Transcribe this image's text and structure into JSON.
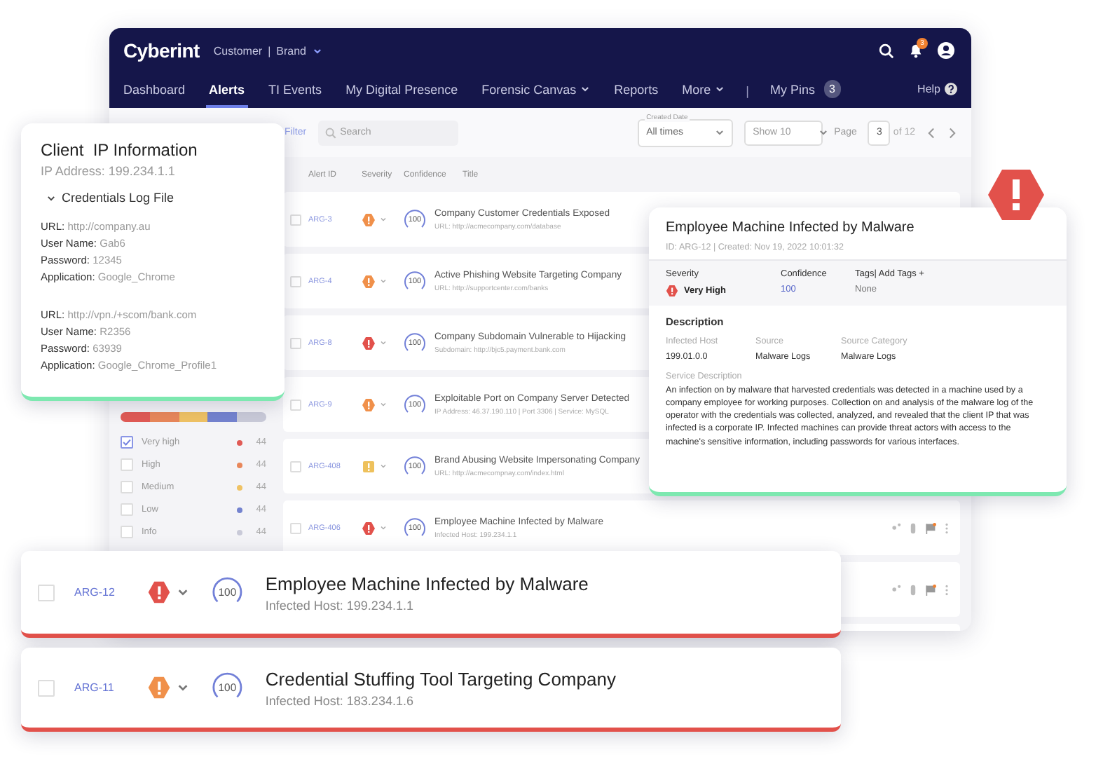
{
  "app": {
    "logo": "Cyberint",
    "account": {
      "customer": "Customer",
      "separator": "|",
      "brand": "Brand"
    },
    "notification_count": "3",
    "nav": [
      {
        "label": "Dashboard",
        "selected": false,
        "dropdown": false
      },
      {
        "label": "Alerts",
        "selected": true,
        "dropdown": false
      },
      {
        "label": "TI Events",
        "selected": false,
        "dropdown": false
      },
      {
        "label": "My Digital Presence",
        "selected": false,
        "dropdown": false
      },
      {
        "label": "Forensic Canvas",
        "selected": false,
        "dropdown": true
      },
      {
        "label": "Reports",
        "selected": false,
        "dropdown": false
      },
      {
        "label": "More",
        "selected": false,
        "dropdown": true
      }
    ],
    "nav_separator": "|",
    "pins": {
      "label": "My Pins",
      "count": "3"
    },
    "help": "Help"
  },
  "toolbar": {
    "filter": "Filter",
    "search": {
      "placeholder": "Search"
    },
    "created_date": {
      "label": "Created Date",
      "value": "All times"
    },
    "show": "Show 10",
    "page_label": "Page",
    "page": "3",
    "page_total": "of 12"
  },
  "severity_filter": [
    {
      "label": "Very high",
      "checked": true,
      "color": "#e05a55",
      "count": "44"
    },
    {
      "label": "High",
      "checked": false,
      "color": "#e8875a",
      "count": "44"
    },
    {
      "label": "Medium",
      "checked": false,
      "color": "#efc264",
      "count": "44"
    },
    {
      "label": "Low",
      "checked": false,
      "color": "#7483cf",
      "count": "44"
    },
    {
      "label": "Info",
      "checked": false,
      "color": "#c9cad8",
      "count": "44"
    }
  ],
  "table": {
    "columns": [
      "Alert ID",
      "Severity",
      "Confidence",
      "Title"
    ],
    "rows": [
      {
        "id": "ARG-3",
        "checked": false,
        "kind": "high",
        "confidence": "100",
        "title": "Company Customer Credentials Exposed",
        "detail": "URL: http://acmecompany.com/database"
      },
      {
        "id": "ARG-4",
        "checked": false,
        "kind": "high",
        "confidence": "100",
        "title": "Active Phishing Website Targeting Company",
        "detail": "URL: http://supportcenter.com/banks"
      },
      {
        "id": "ARG-8",
        "checked": false,
        "kind": "very_high",
        "confidence": "100",
        "title": "Company Subdomain Vulnerable to Hijacking",
        "detail": "Subdomain: http://bjc5.payment.bank.com"
      },
      {
        "id": "ARG-9",
        "checked": false,
        "kind": "high",
        "confidence": "100",
        "title": "Exploitable Port on Company Server Detected",
        "detail": "IP Address: 46.37.190.110 | Port 3306 | Service: MySQL"
      },
      {
        "id": "ARG-408",
        "checked": false,
        "kind": "medium",
        "confidence": "100",
        "title": "Brand Abusing Website Impersonating Company",
        "detail": "URL: http://acmecompnay.com/index.html"
      },
      {
        "id": "ARG-406",
        "checked": false,
        "kind": "very_high",
        "confidence": "100",
        "title": "Employee Machine Infected by Malware",
        "detail": "Infected Host: 199.234.1.1"
      }
    ]
  },
  "ip_card": {
    "title": "Client  IP Information",
    "subtitle": "IP Address: 199.234.1.1",
    "section": "Credentials Log File",
    "expanded": true,
    "entries": [
      [
        {
          "label": "URL:",
          "value": "http://company.au"
        },
        {
          "label": "User Name:",
          "value": "Gab6"
        },
        {
          "label": "Password:",
          "value": "12345"
        },
        {
          "label": "Application:",
          "value": "Google_Chrome"
        }
      ],
      [
        {
          "label": "URL:",
          "value": "http://vpn./+scom/bank.com"
        },
        {
          "label": "User Name:",
          "value": "R2356"
        },
        {
          "label": "Password:",
          "value": "63939"
        },
        {
          "label": "Application:",
          "value": "Google_Chrome_Profile1"
        }
      ]
    ]
  },
  "detail_card": {
    "title": "Employee Machine Infected by Malware",
    "meta": "ID: ARG-12 | Created: Nov 19, 2022 10:01:32",
    "fields": [
      {
        "label": "Severity",
        "value": "Very High",
        "kind": "severity"
      },
      {
        "label": "Confidence",
        "value": "100",
        "kind": "link"
      },
      {
        "label": "Tags| Add Tags +",
        "value": "None",
        "kind": "muted"
      }
    ],
    "section": "Description",
    "facts": [
      {
        "label": "Infected Host",
        "value": "199.01.0.0"
      },
      {
        "label": "Source",
        "value": "Malware Logs"
      },
      {
        "label": "Source Category",
        "value": "Malware Logs"
      }
    ],
    "service_label": "Service Description",
    "service_text": "An infection on by malware that harvested credentials was detected in a machine used by a company employee for working purposes. Collection on and analysis of the malware log of the operator with the credentials was collected, analyzed, and revealed that the client IP that was infected is a corporate IP. Infected machines can provide threat actors with access to the machine's sensitive information, including passwords for various interfaces."
  },
  "highlight_cards": [
    {
      "id": "ARG-12",
      "checked": false,
      "kind": "very_high",
      "confidence": "100",
      "title": "Employee Machine Infected by Malware",
      "detail": "Infected Host: 199.234.1.1"
    },
    {
      "id": "ARG-11",
      "checked": false,
      "kind": "high",
      "confidence": "100",
      "title": "Credential Stuffing Tool Targeting Company",
      "detail": "Infected Host: 183.234.1.6"
    }
  ]
}
